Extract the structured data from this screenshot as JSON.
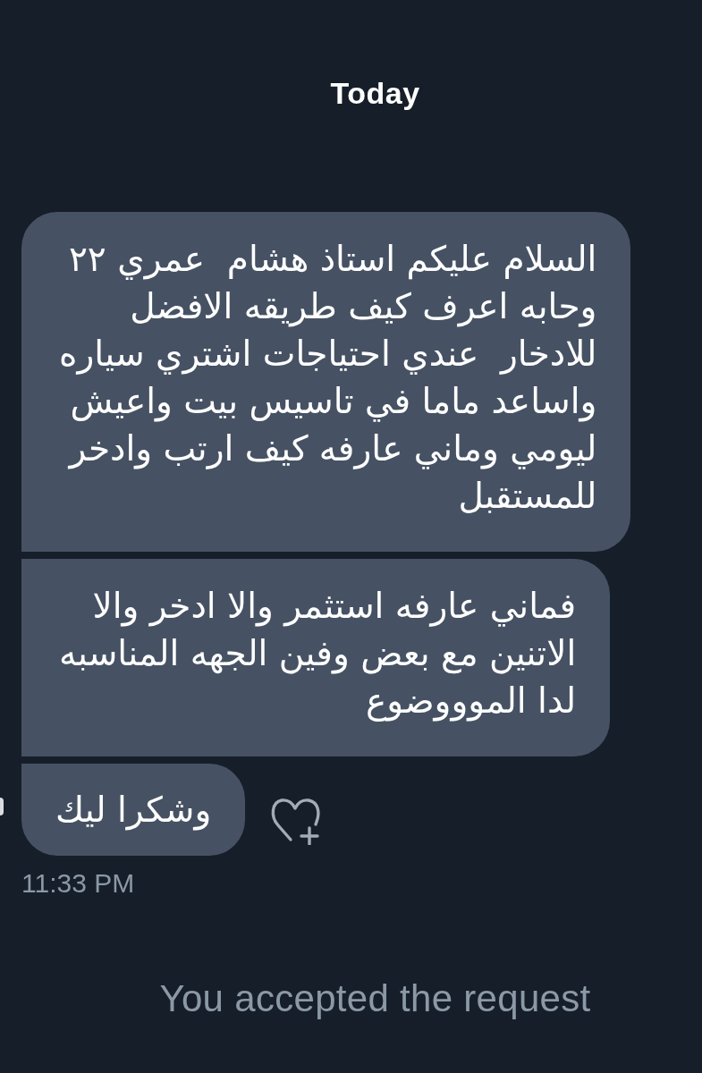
{
  "header": {
    "date": "Today"
  },
  "messages": [
    {
      "text": "السلام عليكم استاذ هشام  عمري ٢٢\nوحابه اعرف كيف طريقه الافضل\nللادخار  عندي احتياجات اشتري سياره\nواساعد ماما في تاسيس بيت واعيش\nليومي وماني عارفه كيف ارتب وادخر\nللمستقبل"
    },
    {
      "text": "فماني عارفه استثمر والا ادخر والا\nالاتنين مع بعض وفين الجهه المناسبه\nلدا الموووضوع"
    },
    {
      "text": "وشكرا ليك"
    }
  ],
  "timestamp": "11:33 PM",
  "notice": "You accepted the request"
}
